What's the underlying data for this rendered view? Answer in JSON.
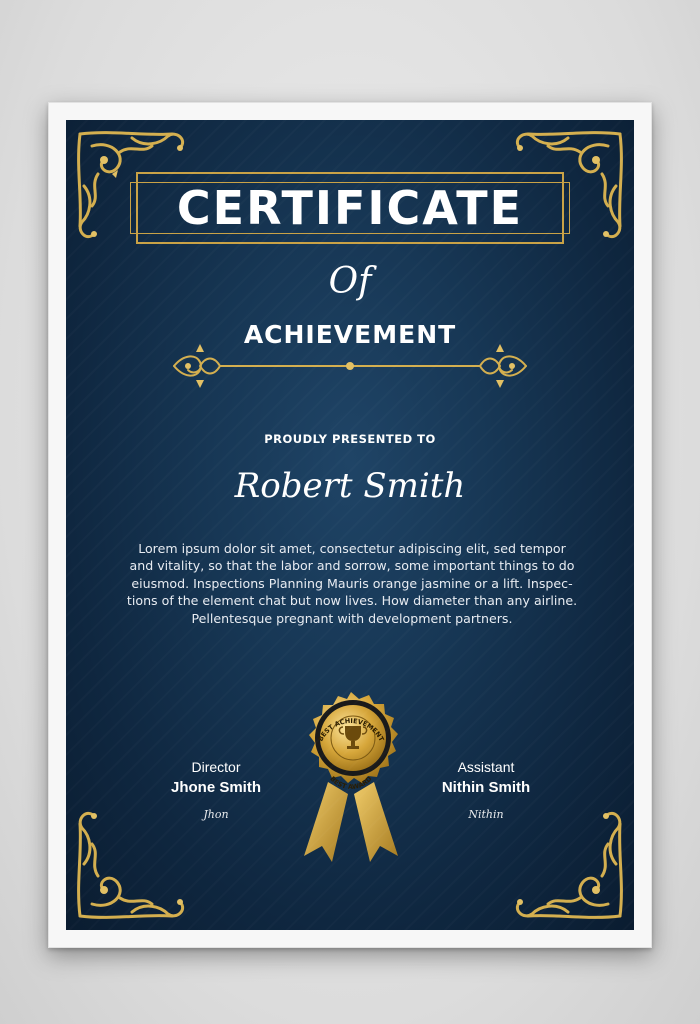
{
  "certificate": {
    "title": "CERTIFICATE",
    "of": "Of",
    "subtitle": "ACHIEVEMENT",
    "presented_label": "PROUDLY PRESENTED TO",
    "recipient_name": "Robert Smith",
    "body_lines": [
      "Lorem ipsum dolor sit amet, consectetur adipiscing elit, sed tempor",
      "and vitality, so that the labor and sorrow, some important things to do",
      "eiusmod. Inspections Planning Mauris orange jasmine or a lift. Inspec-",
      "tions of the element chat but now lives. How diameter than any airline.",
      "Pellentesque pregnant with development partners."
    ]
  },
  "signatures": {
    "left": {
      "role": "Director",
      "name": "Jhone Smith",
      "signature": "Jhon"
    },
    "right": {
      "role": "Assistant",
      "name": "Nithin Smith",
      "signature": "Nithin"
    }
  },
  "seal": {
    "top_text": "BEST ACHIEVEMENT",
    "bottom_text": "BEST AWARD",
    "icon": "trophy-icon"
  },
  "colors": {
    "background": "#173755",
    "gold": "#c9a246",
    "text": "#ffffff",
    "frame": "#f7f7f7"
  }
}
